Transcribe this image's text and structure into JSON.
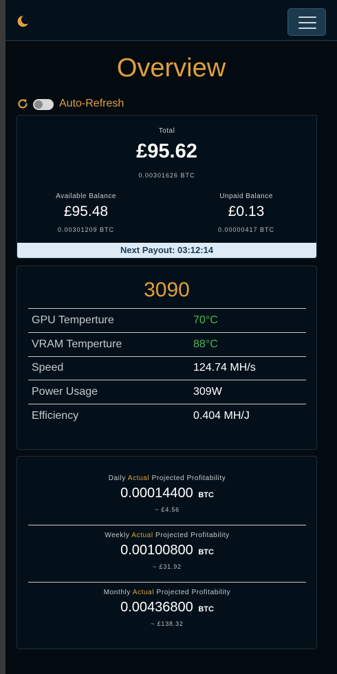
{
  "header": {
    "title": "Overview",
    "auto_refresh_label": "Auto-Refresh",
    "auto_refresh_on": false,
    "theme_icon": "moon-icon",
    "menu_icon": "hamburger-icon",
    "refresh_icon": "refresh-icon",
    "accent_color": "#e0a03c"
  },
  "balance": {
    "total_label": "Total",
    "total_fiat": "£95.62",
    "total_btc": "0.00301626 BTC",
    "available_label": "Available Balance",
    "available_fiat": "£95.48",
    "available_btc": "0.00301209 BTC",
    "unpaid_label": "Unpaid Balance",
    "unpaid_fiat": "£0.13",
    "unpaid_btc": "0.00000417 BTC",
    "next_payout": "Next Payout: 03:12:14"
  },
  "gpu": {
    "name": "3090",
    "stats": [
      {
        "label": "GPU Temperture",
        "value": "70°C",
        "highlight": "green"
      },
      {
        "label": "VRAM Temperture",
        "value": "88°C",
        "highlight": "green"
      },
      {
        "label": "Speed",
        "value": "124.74 MH/s",
        "highlight": ""
      },
      {
        "label": "Power Usage",
        "value": "309W",
        "highlight": ""
      },
      {
        "label": "Efficiency",
        "value": "0.404 MH/J",
        "highlight": ""
      }
    ]
  },
  "profitability": {
    "actual_word": "Actual",
    "suffix": "Projected Profitability",
    "unit": "BTC",
    "rows": [
      {
        "period": "Daily",
        "value": "0.00014400",
        "fiat": "~ £4.56"
      },
      {
        "period": "Weekly",
        "value": "0.00100800",
        "fiat": "~ £31.92"
      },
      {
        "period": "Monthly",
        "value": "0.00436800",
        "fiat": "~ £138.32"
      }
    ]
  }
}
